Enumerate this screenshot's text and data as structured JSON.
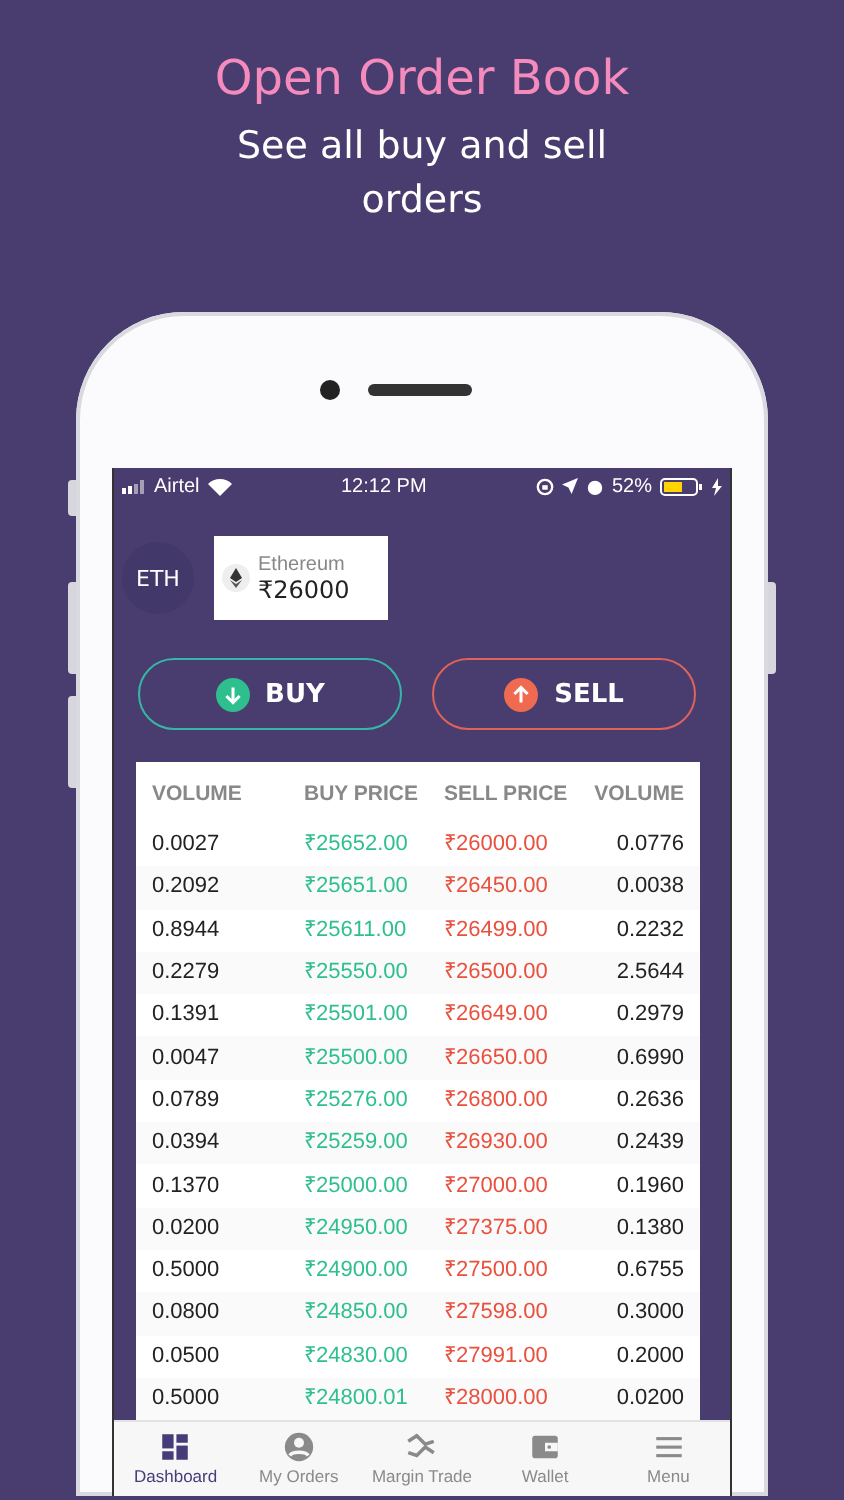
{
  "promo": {
    "title": "Open Order Book",
    "subtitle": "See all buy and sell orders"
  },
  "status_bar": {
    "carrier": "Airtel",
    "time": "12:12 PM",
    "battery": "52%"
  },
  "coin": {
    "symbol": "ETH",
    "name": "Ethereum",
    "price": "₹26000"
  },
  "actions": [
    {
      "kind": "buy",
      "label": "BUY"
    },
    {
      "kind": "sell",
      "label": "SELL"
    }
  ],
  "order_book": {
    "columns": [
      "VOLUME",
      "BUY PRICE",
      "SELL PRICE",
      "VOLUME"
    ],
    "rows": [
      [
        "0.0027",
        "₹25652.00",
        "₹26000.00",
        "0.0776"
      ],
      [
        "0.2092",
        "₹25651.00",
        "₹26450.00",
        "0.0038"
      ],
      [
        "0.8944",
        "₹25611.00",
        "₹26499.00",
        "0.2232"
      ],
      [
        "0.2279",
        "₹25550.00",
        "₹26500.00",
        "2.5644"
      ],
      [
        "0.1391",
        "₹25501.00",
        "₹26649.00",
        "0.2979"
      ],
      [
        "0.0047",
        "₹25500.00",
        "₹26650.00",
        "0.6990"
      ],
      [
        "0.0789",
        "₹25276.00",
        "₹26800.00",
        "0.2636"
      ],
      [
        "0.0394",
        "₹25259.00",
        "₹26930.00",
        "0.2439"
      ],
      [
        "0.1370",
        "₹25000.00",
        "₹27000.00",
        "0.1960"
      ],
      [
        "0.0200",
        "₹24950.00",
        "₹27375.00",
        "0.1380"
      ],
      [
        "0.5000",
        "₹24900.00",
        "₹27500.00",
        "0.6755"
      ],
      [
        "0.0800",
        "₹24850.00",
        "₹27598.00",
        "0.3000"
      ],
      [
        "0.0500",
        "₹24830.00",
        "₹27991.00",
        "0.2000"
      ],
      [
        "0.5000",
        "₹24800.01",
        "₹28000.00",
        "0.0200"
      ]
    ]
  },
  "tab_bar": [
    {
      "label": "Dashboard",
      "selected": true
    },
    {
      "label": "My Orders",
      "selected": false
    },
    {
      "label": "Margin Trade",
      "selected": false
    },
    {
      "label": "Wallet",
      "selected": false
    },
    {
      "label": "Menu",
      "selected": false
    }
  ]
}
